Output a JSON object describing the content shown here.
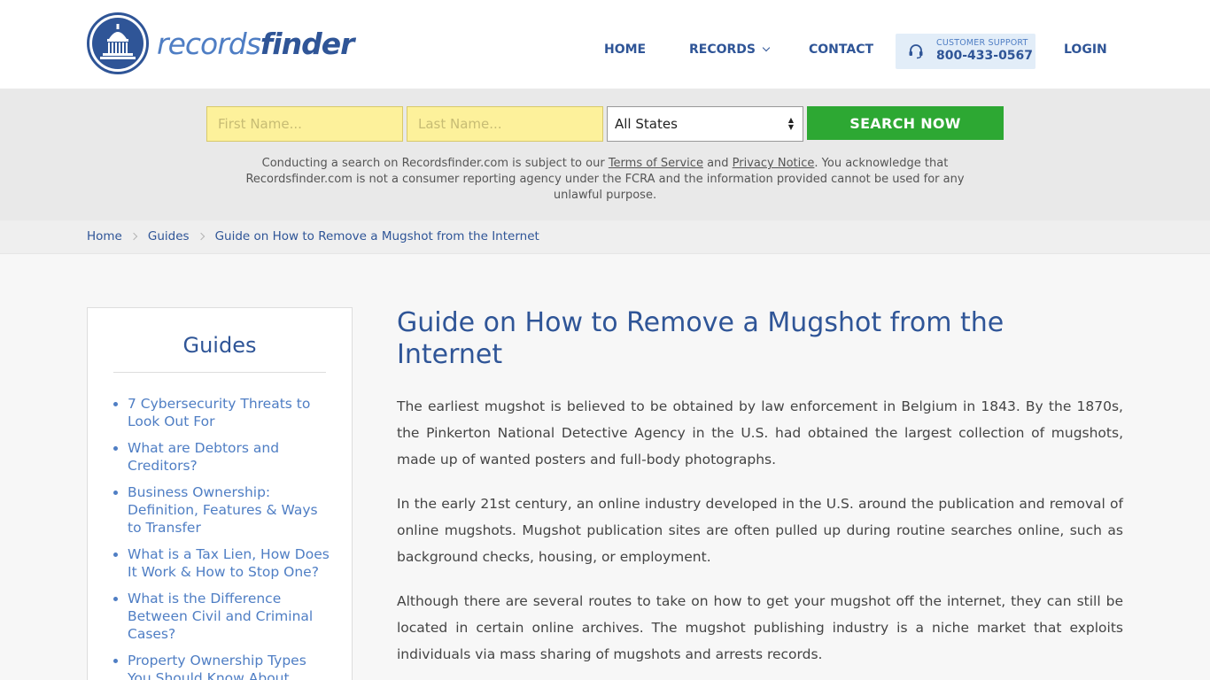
{
  "header": {
    "logo": {
      "part1": "records",
      "part2": "finder"
    },
    "nav": {
      "home": "HOME",
      "records": "RECORDS",
      "contact": "CONTACT",
      "login": "LOGIN"
    },
    "support": {
      "label": "CUSTOMER SUPPORT",
      "phone": "800-433-0567"
    }
  },
  "search": {
    "first_name_placeholder": "First Name...",
    "last_name_placeholder": "Last Name...",
    "state_selected": "All States",
    "button_label": "SEARCH NOW",
    "disclaimer": {
      "pre": "Conducting a search on Recordsfinder.com is subject to our ",
      "tos": "Terms of Service",
      "and": " and ",
      "privacy": "Privacy Notice",
      "post": ". You acknowledge that Recordsfinder.com is not a consumer reporting agency under the FCRA and the information provided cannot be used for any unlawful purpose."
    }
  },
  "breadcrumb": {
    "items": [
      "Home",
      "Guides",
      "Guide on How to Remove a Mugshot from the Internet"
    ]
  },
  "sidebar": {
    "title": "Guides",
    "items": [
      "7 Cybersecurity Threats to Look Out For",
      "What are Debtors and Creditors?",
      "Business Ownership: Definition, Features & Ways to Transfer",
      "What is a Tax Lien, How Does It Work & How to Stop One?",
      "What is the Difference Between Civil and Criminal Cases?",
      "Property Ownership Types You Should Know About"
    ]
  },
  "article": {
    "title": "Guide on How to Remove a Mugshot from the Internet",
    "paragraphs": [
      "The earliest mugshot is believed to be obtained by law enforcement in Belgium in 1843. By the 1870s, the Pinkerton National Detective Agency in the U.S. had obtained the largest collection of mugshots, made up of wanted posters and full-body photographs.",
      "In the early 21st century, an online industry developed in the U.S. around the publication and removal of online mugshots. Mugshot publication sites are often pulled up during routine searches online, such as background checks, housing, or employment.",
      "Although there are several routes to take on how to get your mugshot off the internet, they can still be located in certain online archives. The mugshot publishing industry is a niche market that exploits individuals via mass sharing of mugshots and arrests records."
    ]
  },
  "colors": {
    "brand_blue": "#2f5597",
    "link_blue": "#4f7ec4",
    "search_green": "#2da833",
    "input_yellow": "#fdf19b"
  },
  "icons": {
    "logo": "capitol-dome-icon",
    "support": "headset-icon",
    "records_dropdown": "chevron-down-icon",
    "breadcrumb_separator": "chevron-right-icon",
    "state_select": "select-arrows-icon"
  }
}
